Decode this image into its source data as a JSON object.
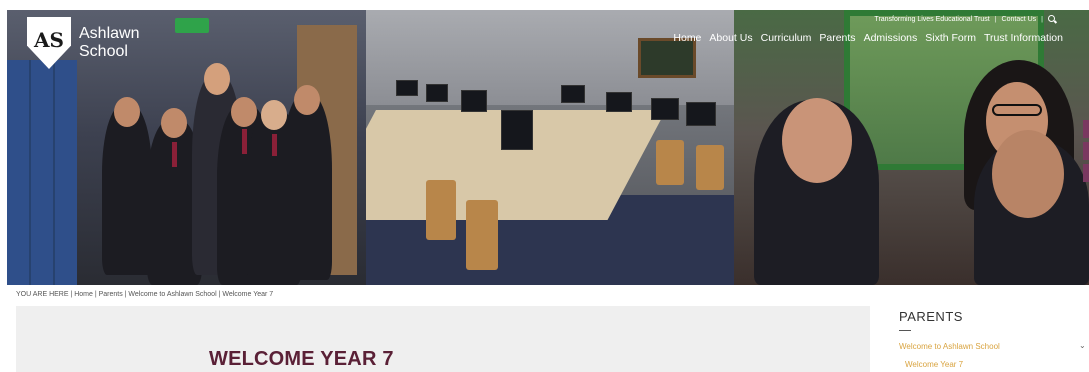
{
  "header": {
    "logo_line1": "Ashlawn",
    "logo_line2": "School",
    "crest_letters": "AS",
    "top_links": [
      "Transforming Lives Educational Trust",
      "Contact Us"
    ],
    "separator": "|",
    "nav": [
      "Home",
      "About Us",
      "Curriculum",
      "Parents",
      "Admissions",
      "Sixth Form",
      "Trust Information"
    ]
  },
  "breadcrumb": "YOU ARE HERE | Home | Parents | Welcome to Ashlawn School  | Welcome Year 7",
  "main": {
    "title": "WELCOME YEAR 7"
  },
  "sidebar": {
    "title": "PARENTS",
    "items": [
      "Welcome to Ashlawn School",
      "Welcome Year 7"
    ],
    "chevron": "⌄"
  },
  "colors": {
    "accent": "#d9a441",
    "title": "#5a2036",
    "background": "#efefef"
  }
}
